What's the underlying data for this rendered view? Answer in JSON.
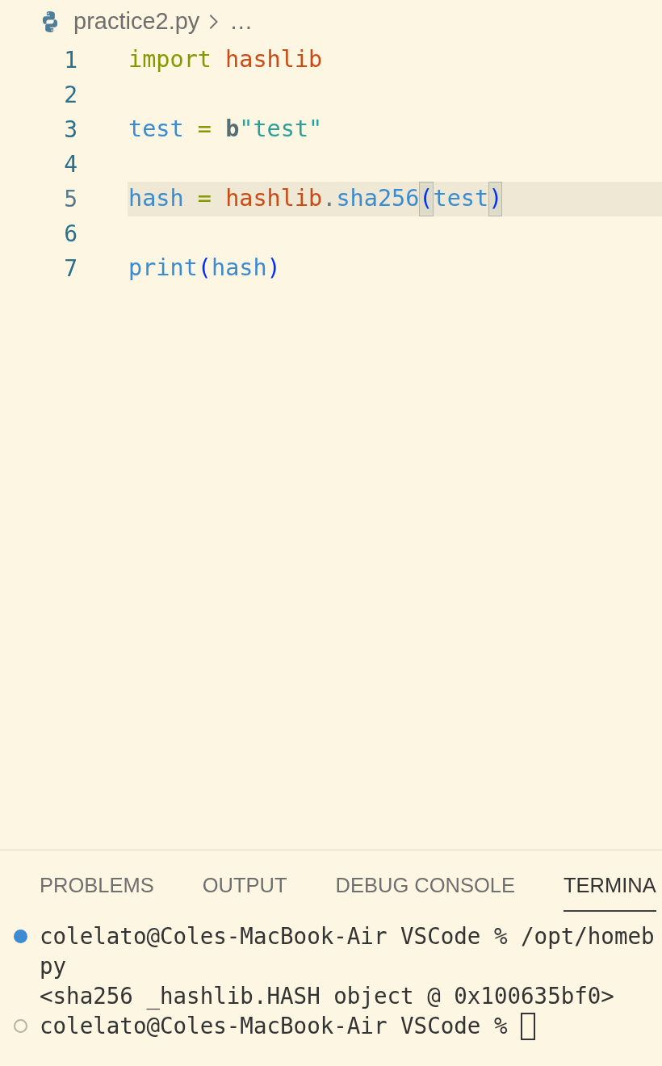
{
  "breadcrumb": {
    "file": "practice2.py",
    "more": "…"
  },
  "editor": {
    "lines": [
      {
        "number": "1",
        "current": false,
        "words": [
          {
            "tokens": [
              {
                "text": "import",
                "kind": "keyword"
              }
            ]
          },
          {
            "tokens": [
              {
                "text": "hashlib",
                "kind": "module"
              }
            ]
          }
        ]
      },
      {
        "number": "2",
        "current": false
      },
      {
        "number": "3",
        "current": false,
        "words": [
          {
            "tokens": [
              {
                "text": "test",
                "kind": "variable"
              }
            ]
          },
          {
            "tokens": [
              {
                "text": "=",
                "kind": "operator"
              }
            ]
          },
          {
            "tokens": [
              {
                "text": "b",
                "kind": "prefix"
              },
              {
                "text": "\"test\"",
                "kind": "string"
              }
            ]
          }
        ]
      },
      {
        "number": "4",
        "current": false
      },
      {
        "number": "5",
        "current": true,
        "words": [
          {
            "tokens": [
              {
                "text": "hash",
                "kind": "variable"
              }
            ]
          },
          {
            "tokens": [
              {
                "text": "=",
                "kind": "operator"
              }
            ]
          },
          {
            "tokens": [
              {
                "text": "hashlib",
                "kind": "module"
              },
              {
                "text": ".",
                "kind": "punctuation"
              },
              {
                "text": "sha256",
                "kind": "function"
              },
              {
                "text": "(",
                "kind": "bracket",
                "matched": true
              },
              {
                "text": "test",
                "kind": "variable"
              },
              {
                "text": ")",
                "kind": "bracket",
                "matched": true
              }
            ]
          }
        ]
      },
      {
        "number": "6",
        "current": false
      },
      {
        "number": "7",
        "current": false,
        "words": [
          {
            "tokens": [
              {
                "text": "print",
                "kind": "function"
              },
              {
                "text": "(",
                "kind": "bracket",
                "matched": false
              },
              {
                "text": "hash",
                "kind": "variable"
              },
              {
                "text": ")",
                "kind": "bracket",
                "matched": false
              }
            ]
          }
        ]
      }
    ]
  },
  "panel": {
    "tabs": [
      {
        "label": "PROBLEMS",
        "selected": false
      },
      {
        "label": "OUTPUT",
        "selected": false
      },
      {
        "label": "DEBUG CONSOLE",
        "selected": false
      },
      {
        "label": "TERMINA",
        "selected": true
      }
    ],
    "terminal": {
      "lines": [
        {
          "kind": "success",
          "text": "colelato@Coles-MacBook-Air VSCode % /opt/homeb",
          "cursor": false
        },
        {
          "kind": "plain",
          "text": "py",
          "cursor": false
        },
        {
          "kind": "plain",
          "text": "<sha256 _hashlib.HASH object @ 0x100635bf0>",
          "cursor": false
        },
        {
          "kind": "pending",
          "text": "colelato@Coles-MacBook-Air VSCode %",
          "cursor": true
        }
      ]
    }
  }
}
